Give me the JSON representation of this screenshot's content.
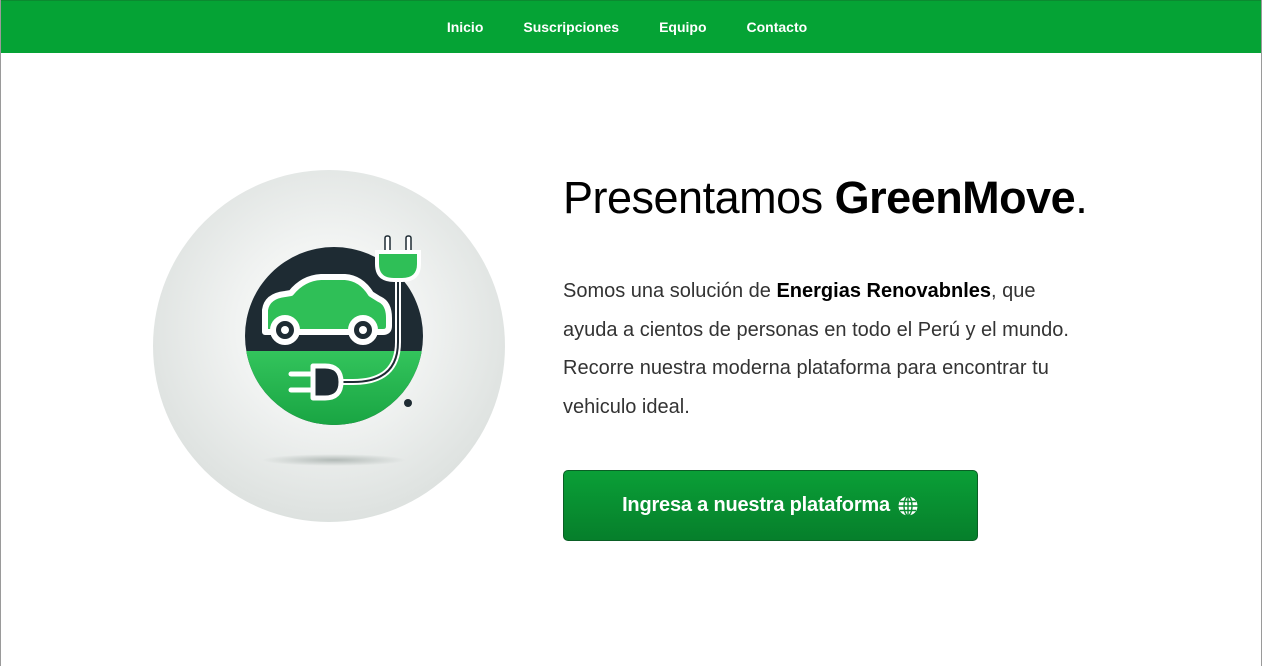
{
  "nav": {
    "items": [
      {
        "label": "Inicio"
      },
      {
        "label": "Suscripciones"
      },
      {
        "label": "Equipo"
      },
      {
        "label": "Contacto"
      }
    ]
  },
  "hero": {
    "title_prefix": "Presentamos ",
    "title_brand": "GreenMove",
    "title_suffix": ".",
    "description": {
      "part1": "Somos una solución de ",
      "bold": "Energias Renovabnles",
      "part2": ", que ayuda a cientos de personas en todo el Perú y el mundo. Recorre nuestra moderna plataforma para encontrar tu vehiculo ideal."
    },
    "cta_label": "Ingresa a nuestra plataforma",
    "cta_icon": "globe-icon",
    "image_icon": "electric-car-plug-logo"
  },
  "colors": {
    "nav_bg": "#05a335",
    "button_bg": "#07902f",
    "logo_dark": "#1e2b33",
    "logo_green": "#1fb34a"
  }
}
